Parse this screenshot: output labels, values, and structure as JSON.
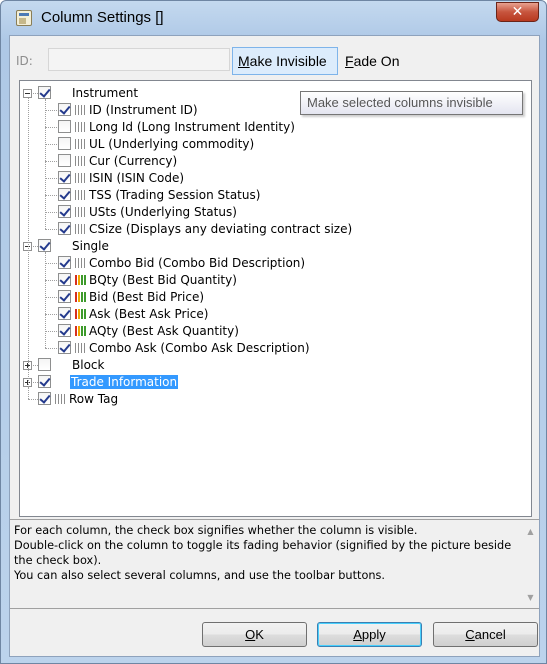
{
  "window": {
    "title": "Column Settings []",
    "close_glyph": "✕"
  },
  "toolbar": {
    "id_label": "ID:",
    "id_value": "",
    "make_invisible": {
      "mnemonic": "M",
      "rest": "ake Invisible"
    },
    "fade_on": {
      "mnemonic": "F",
      "rest": "ade On"
    }
  },
  "tooltip": "Make selected columns invisible",
  "tree": {
    "groups": [
      {
        "label": "Instrument",
        "checked": true,
        "expanded": true,
        "children": [
          {
            "label": "ID (Instrument ID)",
            "checked": true,
            "colored": false
          },
          {
            "label": "Long Id (Long Instrument Identity)",
            "checked": false,
            "colored": false
          },
          {
            "label": "UL (Underlying commodity)",
            "checked": false,
            "colored": false
          },
          {
            "label": "Cur (Currency)",
            "checked": false,
            "colored": false
          },
          {
            "label": "ISIN (ISIN Code)",
            "checked": true,
            "colored": false
          },
          {
            "label": "TSS (Trading Session Status)",
            "checked": true,
            "colored": false
          },
          {
            "label": "USts (Underlying Status)",
            "checked": true,
            "colored": false
          },
          {
            "label": "CSize (Displays any deviating contract size)",
            "checked": true,
            "colored": false
          }
        ]
      },
      {
        "label": "Single",
        "checked": true,
        "expanded": true,
        "children": [
          {
            "label": "Combo Bid (Combo Bid Description)",
            "checked": true,
            "colored": false
          },
          {
            "label": "BQty (Best Bid Quantity)",
            "checked": true,
            "colored": true
          },
          {
            "label": "Bid (Best Bid Price)",
            "checked": true,
            "colored": true
          },
          {
            "label": "Ask (Best Ask Price)",
            "checked": true,
            "colored": true
          },
          {
            "label": "AQty (Best Ask Quantity)",
            "checked": true,
            "colored": true
          },
          {
            "label": "Combo Ask (Combo Ask Description)",
            "checked": true,
            "colored": false
          }
        ]
      },
      {
        "label": "Block",
        "checked": false,
        "expanded": false,
        "children": []
      },
      {
        "label": "Trade Information",
        "checked": true,
        "expanded": false,
        "selected": true,
        "children": []
      }
    ],
    "leaf": {
      "label": "Row Tag",
      "checked": true
    }
  },
  "description": {
    "lines": [
      "For each column, the check box signifies whether the column is visible.",
      "Double-click on the column to toggle its fading behavior (signified by the picture beside the check box).",
      "You can also select several columns, and use the toolbar buttons."
    ]
  },
  "buttons": {
    "ok": {
      "mnemonic": "O",
      "rest": "K"
    },
    "apply": {
      "mnemonic": "A",
      "rest": "pply"
    },
    "cancel": {
      "mnemonic": "C",
      "rest": "ancel"
    }
  },
  "icons": {
    "app": "app-icon",
    "close": "close-icon",
    "checkbox": "checkbox-icon",
    "expander": "expander-icon",
    "column_bars": "column-bars-icon"
  },
  "colors": {
    "selection": "#3399ff",
    "bars_plain": "#8c8c8c",
    "bars_colored": [
      "#d7301f",
      "#f0a800",
      "#3d9a2b"
    ]
  }
}
